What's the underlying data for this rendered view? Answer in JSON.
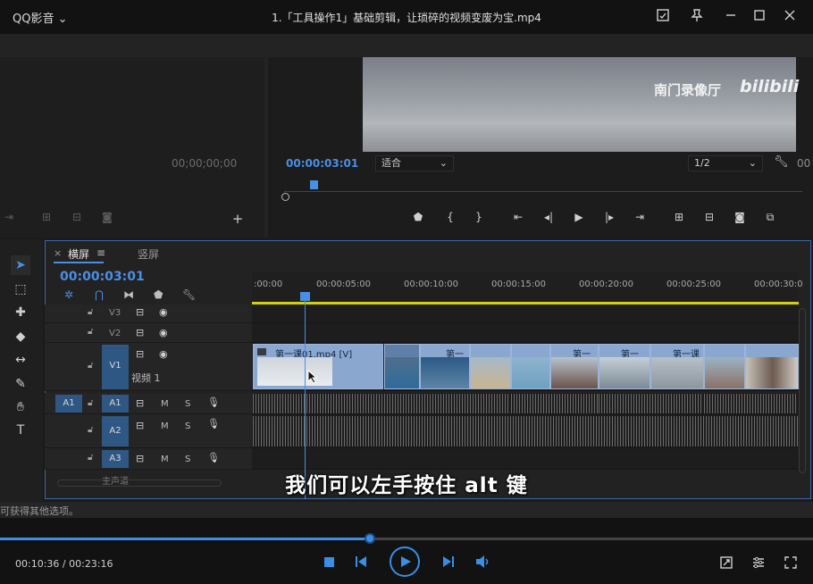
{
  "player": {
    "app_name": "QQ影音",
    "app_chevron": "⌄",
    "video_title": "1.「工具操作1」基础剪辑，让琐碎的视频变废为宝.mp4",
    "time_current": "00:10:36",
    "time_separator": " / ",
    "time_total": "00:23:16",
    "progress": 0.4545,
    "accent_color": "#3a8ee6",
    "subtitle": "我们可以左手按住 alt 键",
    "icons": [
      "screenshot-icon",
      "pin-icon",
      "minimize-icon",
      "maximize-icon",
      "close-icon",
      "stop-icon",
      "previous-icon",
      "play-icon",
      "next-icon",
      "volume-icon",
      "capture-icon",
      "settings-icon",
      "fullscreen-icon"
    ]
  },
  "premiere": {
    "source_timecode": "00;00;00;00",
    "program_timecode": "00:00:03:01",
    "fit_label": "适合",
    "resolution_label": "1/2",
    "program_timecode_partial": "00",
    "watermark": "南门录像厅",
    "watermark_brand": "bilibili",
    "timeline": {
      "tab_close": "×",
      "tab_active": "横屏",
      "tab_menu": "≡",
      "tab_other": "竖屏",
      "timecode": "00:00:03:01",
      "ruler_ticks": [
        ":00:00",
        "00:00:05:00",
        "00:00:10:00",
        "00:00:15:00",
        "00:00:20:00",
        "00:00:25:00",
        "00:00:30:0"
      ],
      "tracks": {
        "v3": "V3",
        "v2": "V2",
        "v1": "V1",
        "v1_name": "视频 1",
        "a1_source": "A1",
        "a1": "A1",
        "a2": "A2",
        "a3": "A3",
        "mix_label": "主声道",
        "m": "M",
        "s": "S"
      },
      "clip_label": "第一课01.mp4 [V]",
      "clip_short_1": "第一",
      "clip_short_2": "第一",
      "clip_short_3": "第一",
      "clip_short_4": "第一课",
      "work_area_color": "#d7d000"
    },
    "status_text": "可获得其他选项。"
  }
}
